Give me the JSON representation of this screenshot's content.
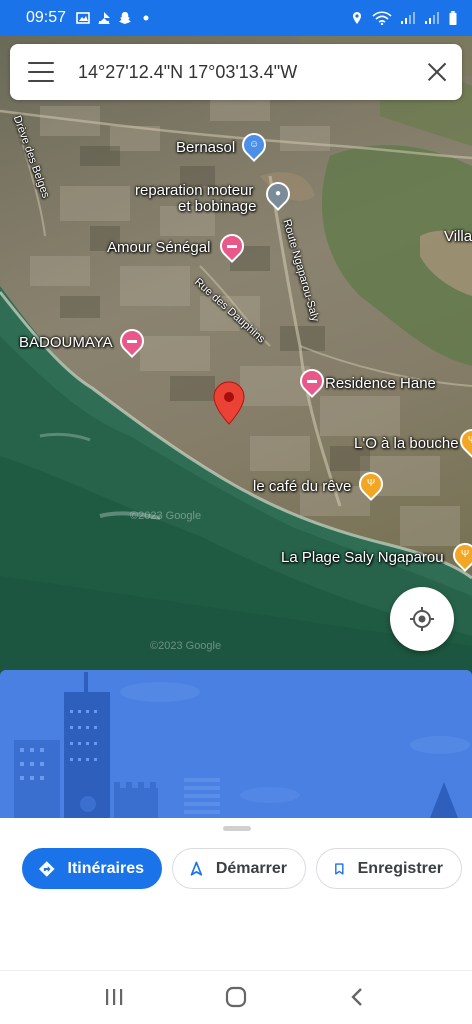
{
  "status_bar": {
    "time": "09:57",
    "left_icons": [
      "image-icon",
      "mail-icon",
      "snapchat-icon",
      "dot-icon"
    ],
    "right_icons": [
      "location-icon",
      "wifi-icon",
      "signal-icon",
      "signal2-icon",
      "battery-icon"
    ]
  },
  "search": {
    "query": "14°27'12.4\"N 17°03'13.4\"W"
  },
  "map": {
    "roads": {
      "drive_des_belges": "Drève des Belges",
      "route_ngaparou_saly": "Route Ngaparou-Saly",
      "rue_des_dauphins": "Rue des Dauphins"
    },
    "places": {
      "bernasol": "Bernasol",
      "reparation": "reparation moteur",
      "reparation_2": "et bobinage",
      "amour_senegal": "Amour Sénégal",
      "badoumaya": "BADOUMAYA",
      "residence_hane": "Residence Hane",
      "lo_a_la_bouche": "L'O à la bouche",
      "cafe_du_reve": "le café du rêve",
      "la_plage": "La Plage Saly Ngaparou",
      "villa": "Villa"
    },
    "watermarks": [
      "©2023 Google",
      "©2023 Google"
    ],
    "colors": {
      "hotel_pin": "#e8598a",
      "food_pin": "#f2a623",
      "service_pin": "#7c8b99",
      "selected_pin": "#ea4335",
      "bernasol_pin": "#4b8fe8"
    }
  },
  "actions": {
    "directions": "Itinéraires",
    "start": "Démarrer",
    "save": "Enregistrer"
  },
  "accent": "#1a73e8"
}
